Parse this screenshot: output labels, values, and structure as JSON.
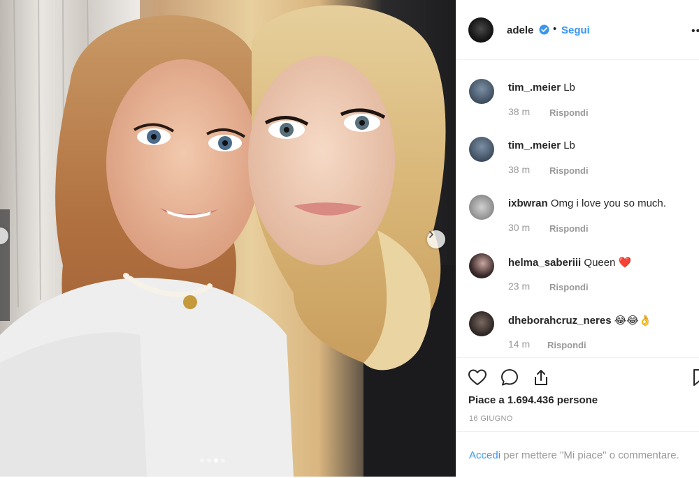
{
  "post": {
    "username": "adele",
    "separator": "•",
    "follow_label": "Segui",
    "more_icon": "ellipsis-icon"
  },
  "comments": [
    {
      "user": "tim_.meier",
      "text": "Lb",
      "time": "38 m",
      "reply": "Rispondi"
    },
    {
      "user": "tim_.meier",
      "text": "Lb",
      "time": "38 m",
      "reply": "Rispondi"
    },
    {
      "user": "ixbwran",
      "text": "Omg i love you so much.",
      "time": "30 m",
      "reply": "Rispondi"
    },
    {
      "user": "helma_saberiii",
      "text": "Queen ❤️",
      "time": "23 m",
      "reply": "Rispondi"
    },
    {
      "user": "dheborahcruz_neres",
      "text": "😂😂👌",
      "time": "14 m",
      "reply": "Rispondi"
    }
  ],
  "actions": {
    "likes_prefix": "Piace a",
    "likes_count": "1.694.436",
    "likes_suffix": "persone",
    "date": "16 GIUGNO"
  },
  "login": {
    "link": "Accedi",
    "text": "per mettere \"Mi piace\" o commentare."
  },
  "carousel": {
    "total": 4,
    "active": 3
  },
  "colors": {
    "accent": "#3897f0",
    "muted": "#999999",
    "text": "#262626"
  }
}
